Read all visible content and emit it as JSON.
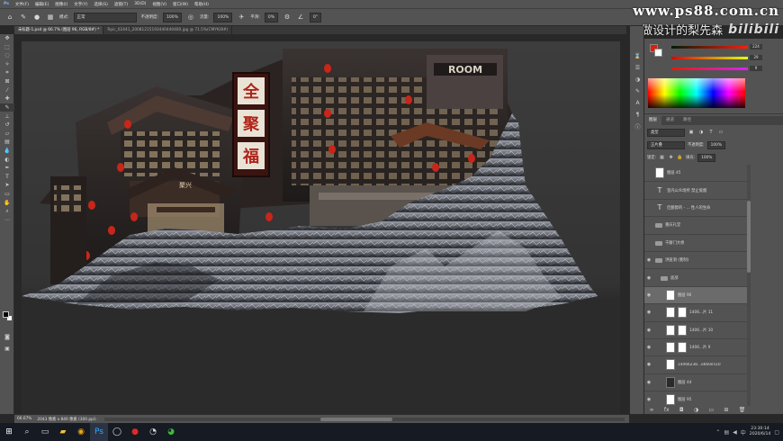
{
  "menu": [
    "文件(F)",
    "编辑(E)",
    "图像(I)",
    "文字(Y)",
    "选择(S)",
    "滤镜(T)",
    "3D(D)",
    "视图(V)",
    "窗口(W)",
    "帮助(H)"
  ],
  "options": {
    "mode_label": "模式:",
    "mode_value": "正常",
    "opacity_label": "不透明度:",
    "opacity_value": "100%",
    "flow_label": "流量:",
    "flow_value": "100%",
    "smooth_label": "平滑:",
    "smooth_value": "0%",
    "angle_value": "0°"
  },
  "watermark": {
    "url": "www.ps88.com.cn",
    "subtitle": "做设计的梨先森",
    "brand": "bilibili"
  },
  "tabs": [
    {
      "label": "未标题-1.psd @ 66.7% (图层 96, RGB/8#) *",
      "active": true
    },
    {
      "label": "Rpic_02441_20081215193440440400.jpg @ 71.5%(CMYK/8#)",
      "active": false
    }
  ],
  "color_panel": {
    "r_value": "224",
    "g_value": "29",
    "b_value": "9"
  },
  "layers_tabs": [
    "图层",
    "通道",
    "路径"
  ],
  "layer_filter": {
    "kind": "类型",
    "blend": "正片叠",
    "opacity_label": "不透明度:",
    "opacity": "100%",
    "lock_label": "锁定:",
    "fill_label": "填充:",
    "fill": "100%"
  },
  "layers": [
    {
      "name": "图层 45",
      "type": "thumb",
      "visible": false,
      "indent": 0
    },
    {
      "name": "室内公众场所 禁止吸烟",
      "type": "text",
      "visible": false,
      "indent": 0
    },
    {
      "name": "佳酿醇的 - ... 性人的生命",
      "type": "text",
      "visible": false,
      "indent": 0
    },
    {
      "name": "重庆礼堂",
      "type": "folder",
      "visible": false,
      "indent": 0
    },
    {
      "name": "千厮门大桥",
      "type": "folder",
      "visible": false,
      "indent": 0
    },
    {
      "name": "洪崖洞 (重制)",
      "type": "folder",
      "visible": true,
      "indent": 0
    },
    {
      "name": "底部",
      "type": "folder",
      "visible": true,
      "indent": 1
    },
    {
      "name": "图层 96",
      "type": "thumb",
      "visible": true,
      "indent": 2,
      "selected": true
    },
    {
      "name": "1406...片 11",
      "type": "mask",
      "visible": true,
      "indent": 2
    },
    {
      "name": "1406...片 10",
      "type": "mask",
      "visible": true,
      "indent": 2
    },
    {
      "name": "1406...片 9",
      "type": "mask",
      "visible": true,
      "indent": 2
    },
    {
      "name": "14066238...o660e510",
      "type": "thumb",
      "visible": true,
      "indent": 2
    },
    {
      "name": "图层 44",
      "type": "thumb",
      "visible": true,
      "indent": 2
    },
    {
      "name": "图层 95",
      "type": "thumb",
      "visible": true,
      "indent": 2
    },
    {
      "name": "14066238-4...1c660e510",
      "type": "thumb",
      "visible": true,
      "indent": 2
    },
    {
      "name": "1406...图片 13",
      "type": "mask",
      "visible": true,
      "indent": 2
    },
    {
      "name": "14066238...片 12",
      "type": "mask",
      "visible": true,
      "indent": 2
    }
  ],
  "status": {
    "zoom": "66.67%",
    "doc": "2043 像素 x 846 像素 (300 ppi)"
  },
  "taskbar": {
    "time": "23:30:14",
    "date": "2020/6/14"
  },
  "signs": {
    "vertical_top": "全",
    "vertical_mid": "聚",
    "vertical_low": "福",
    "balcony": "聚兴",
    "sign_top": "ROOM"
  }
}
